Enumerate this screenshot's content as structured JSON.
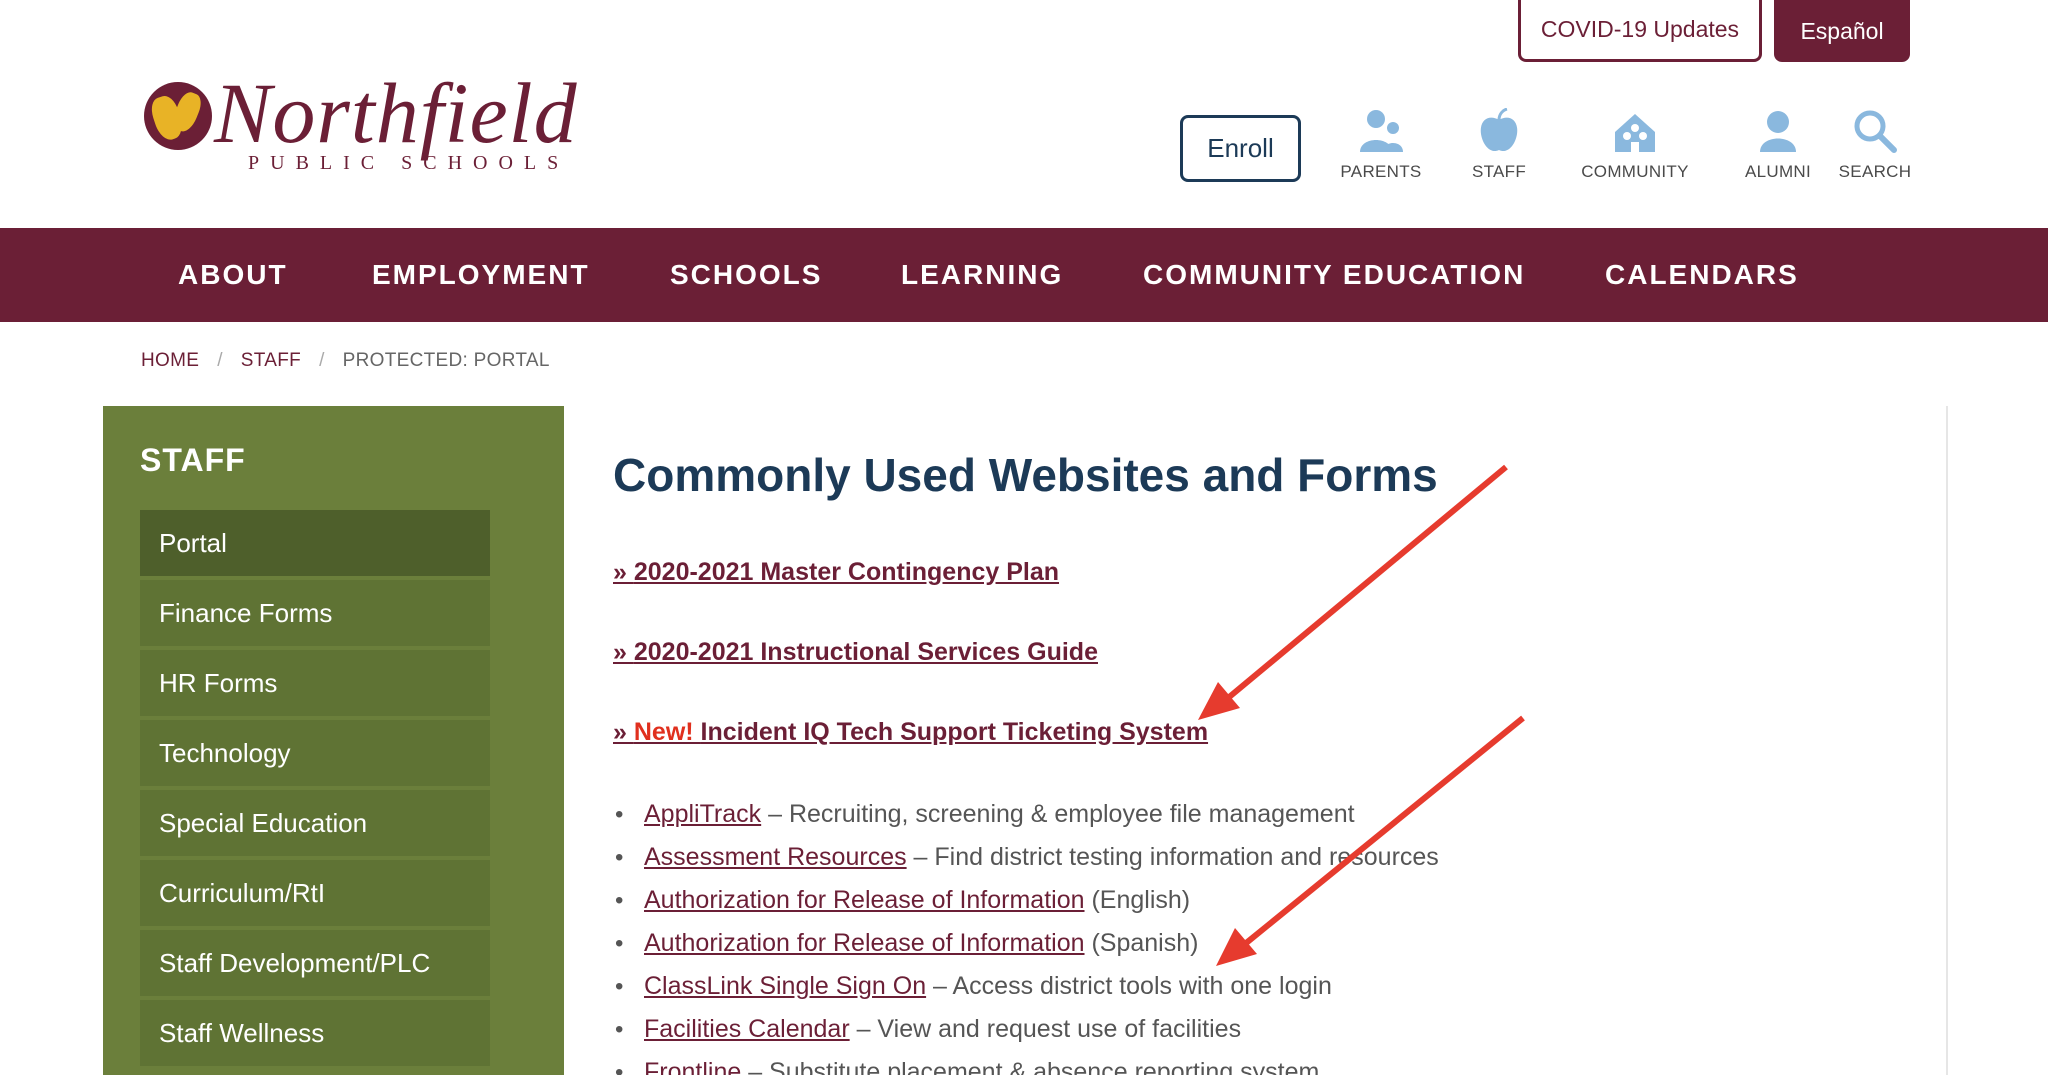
{
  "top_buttons": {
    "covid": "COVID-19 Updates",
    "espanol": "Español"
  },
  "logo": {
    "wordmark": "Northfield",
    "subtitle": "PUBLIC SCHOOLS"
  },
  "header": {
    "enroll": "Enroll",
    "quick_links": [
      {
        "label": "PARENTS",
        "icon": "parents-icon"
      },
      {
        "label": "STAFF",
        "icon": "apple-icon"
      },
      {
        "label": "COMMUNITY",
        "icon": "community-icon"
      },
      {
        "label": "ALUMNI",
        "icon": "alumni-icon"
      },
      {
        "label": "SEARCH",
        "icon": "search-icon"
      }
    ]
  },
  "nav": [
    "ABOUT",
    "EMPLOYMENT",
    "SCHOOLS",
    "LEARNING",
    "COMMUNITY EDUCATION",
    "CALENDARS"
  ],
  "breadcrumb": [
    "HOME",
    "STAFF",
    "PROTECTED: PORTAL"
  ],
  "sidebar": {
    "title": "STAFF",
    "items": [
      "Portal",
      "Finance Forms",
      "HR Forms",
      "Technology",
      "Special Education",
      "Curriculum/RtI",
      "Staff Development/PLC",
      "Staff Wellness"
    ]
  },
  "main": {
    "title": "Commonly Used Websites and Forms",
    "featured": [
      {
        "prefix": "» ",
        "tag": "",
        "text": "2020-2021 Master Contingency Plan"
      },
      {
        "prefix": "» ",
        "tag": "",
        "text": "2020-2021 Instructional Services Guide"
      },
      {
        "prefix": "» ",
        "tag": "New! ",
        "text": "Incident IQ Tech Support Ticketing System"
      }
    ],
    "links": [
      {
        "link": "AppliTrack",
        "desc": " – Recruiting, screening & employee file management"
      },
      {
        "link": "Assessment Resources",
        "desc": " – Find district testing information and resources"
      },
      {
        "link": "Authorization for Release of Information",
        "desc": " (English)"
      },
      {
        "link": "Authorization for Release of Information",
        "desc": " (Spanish)"
      },
      {
        "link": "ClassLink Single Sign On",
        "desc": " – Access district tools with one login"
      },
      {
        "link": "Facilities Calendar",
        "desc": " – View and request use of facilities"
      },
      {
        "link": "Frontline",
        "desc": " – Substitute placement & absence reporting system"
      }
    ]
  },
  "colors": {
    "maroon": "#6b1f36",
    "navy": "#1c3a57",
    "olive": "#6b7f3b",
    "annotation_red": "#e63b2e",
    "icon_blue": "#8ab8de"
  }
}
